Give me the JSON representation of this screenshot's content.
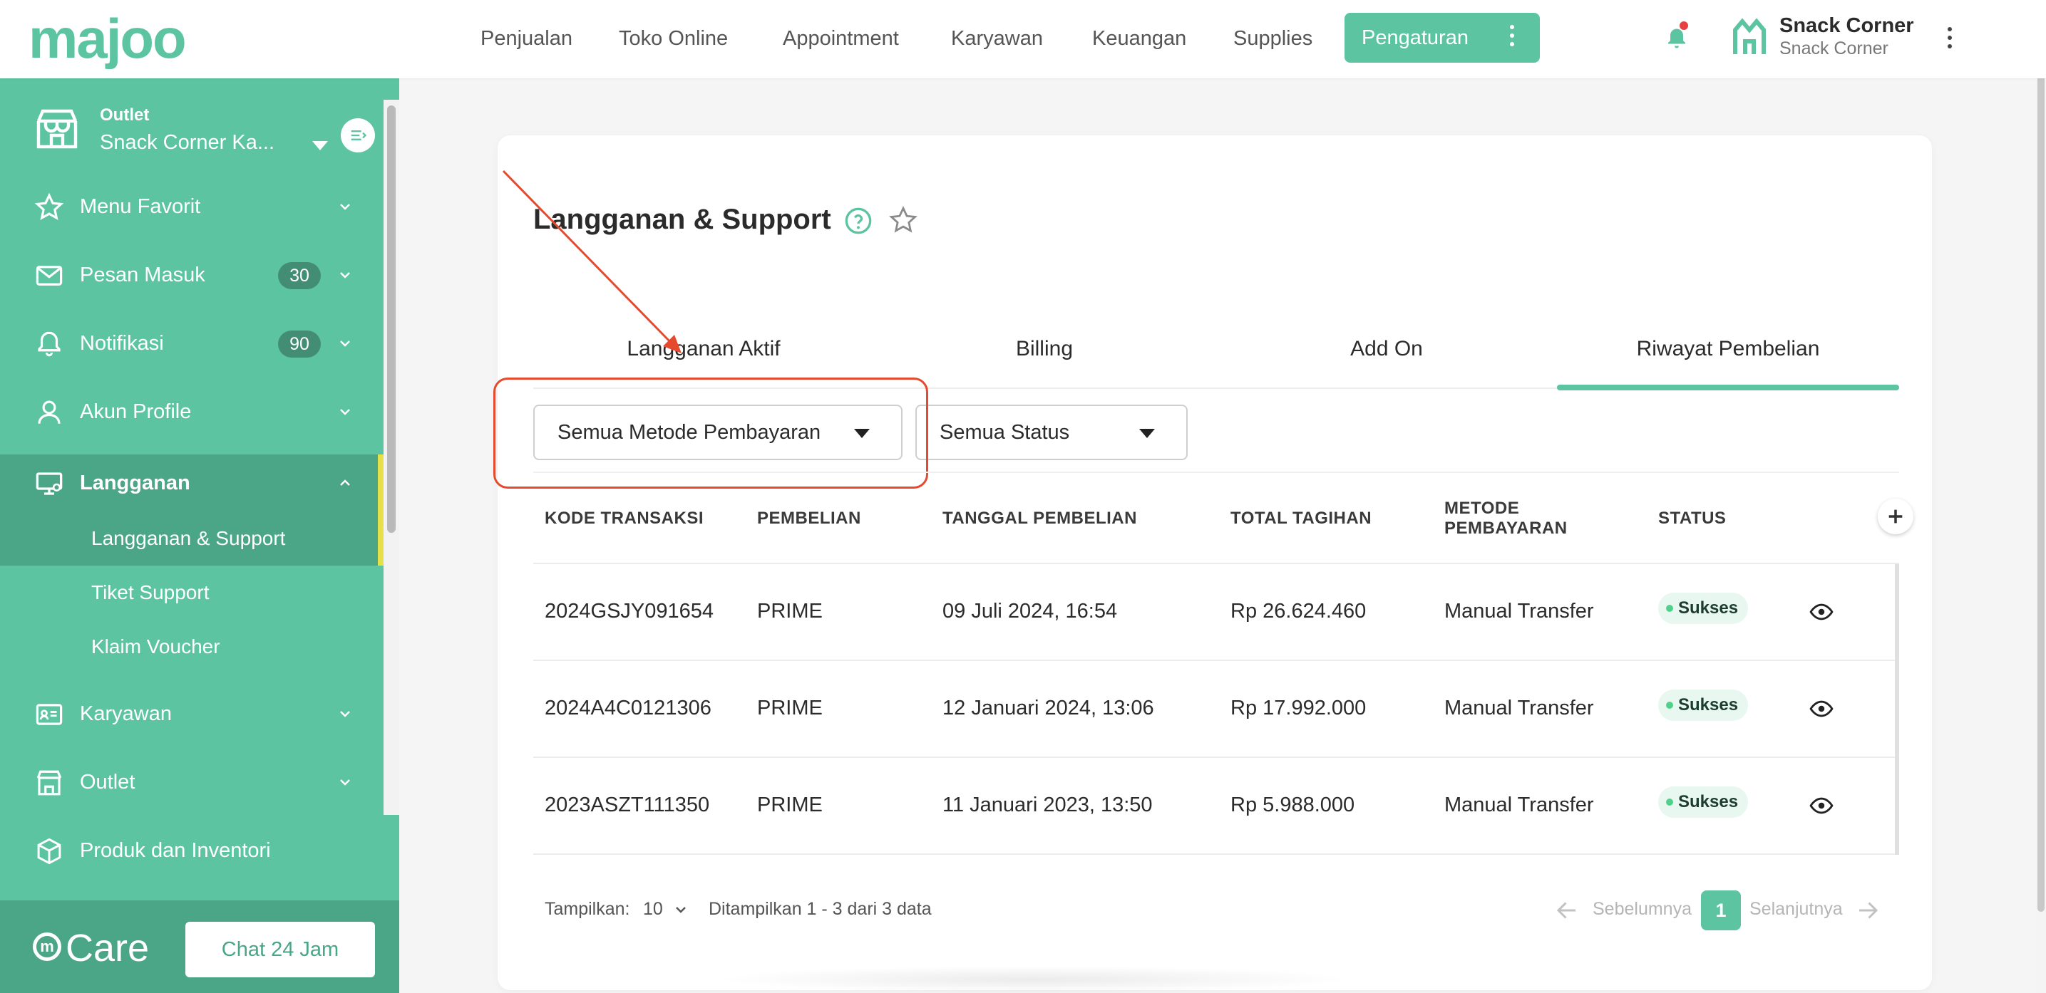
{
  "brand": {
    "logo_text": "majoo",
    "accent": "#5cc4a0",
    "accent_dark": "#4aa686"
  },
  "topnav": {
    "items": [
      "Penjualan",
      "Toko Online",
      "Appointment",
      "Karyawan",
      "Keuangan",
      "Supplies"
    ],
    "active": "Pengaturan"
  },
  "user": {
    "name": "Snack Corner",
    "subtitle": "Snack Corner"
  },
  "sidebar": {
    "outlet_label": "Outlet",
    "outlet_name": "Snack Corner Ka...",
    "items": [
      {
        "label": "Menu Favorit",
        "icon": "star-icon"
      },
      {
        "label": "Pesan Masuk",
        "icon": "mail-icon",
        "badge": "30"
      },
      {
        "label": "Notifikasi",
        "icon": "bell-icon",
        "badge": "90"
      },
      {
        "label": "Akun Profile",
        "icon": "user-icon"
      },
      {
        "label": "Langganan",
        "icon": "monitor-icon"
      },
      {
        "label": "Karyawan",
        "icon": "id-card-icon"
      },
      {
        "label": "Outlet",
        "icon": "store-icon"
      },
      {
        "label": "Produk dan Inventori",
        "icon": "box-icon"
      }
    ],
    "submenu": [
      "Langganan & Support",
      "Tiket Support",
      "Klaim Voucher"
    ],
    "care_label": "Care",
    "chat_button": "Chat 24 Jam"
  },
  "page": {
    "title": "Langganan & Support",
    "tabs": [
      "Langganan Aktif",
      "Billing",
      "Add On",
      "Riwayat Pembelian"
    ],
    "active_tab": "Riwayat Pembelian"
  },
  "filters": {
    "payment_method": "Semua Metode Pembayaran",
    "status": "Semua Status"
  },
  "table": {
    "headers": [
      "KODE TRANSAKSI",
      "PEMBELIAN",
      "TANGGAL PEMBELIAN",
      "TOTAL TAGIHAN",
      "METODE PEMBAYARAN",
      "STATUS"
    ],
    "header_method_line1": "METODE",
    "header_method_line2": "PEMBAYARAN",
    "rows": [
      {
        "code": "2024GSJY091654",
        "item": "PRIME",
        "date": "09 Juli 2024, 16:54",
        "total": "Rp 26.624.460",
        "method": "Manual Transfer",
        "status": "Sukses"
      },
      {
        "code": "2024A4C0121306",
        "item": "PRIME",
        "date": "12 Januari 2024, 13:06",
        "total": "Rp 17.992.000",
        "method": "Manual Transfer",
        "status": "Sukses"
      },
      {
        "code": "2023ASZT111350",
        "item": "PRIME",
        "date": "11 Januari 2023, 13:50",
        "total": "Rp 5.988.000",
        "method": "Manual Transfer",
        "status": "Sukses"
      }
    ]
  },
  "footer": {
    "show_label": "Tampilkan:",
    "show_value": "10",
    "summary": "Ditampilkan 1 - 3 dari 3 data",
    "prev": "Sebelumnya",
    "page": "1",
    "next": "Selanjutnya"
  }
}
